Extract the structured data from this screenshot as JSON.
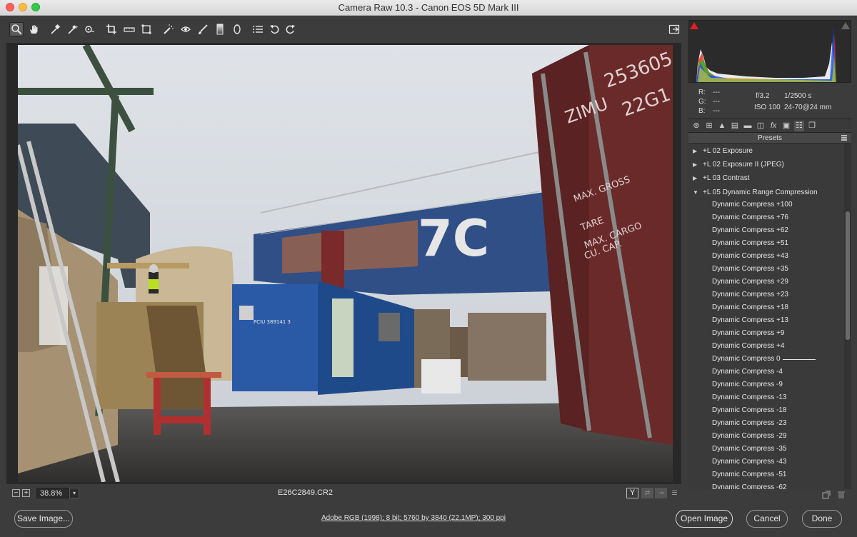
{
  "window": {
    "title": "Camera Raw 10.3  -  Canon EOS 5D Mark III"
  },
  "toolbar": {
    "tools": [
      {
        "icon": "zoom-icon",
        "active": true
      },
      {
        "icon": "hand-icon"
      },
      {
        "icon": "white-balance-icon"
      },
      {
        "icon": "color-sampler-icon"
      },
      {
        "icon": "targeted-adjustment-icon"
      },
      {
        "icon": "crop-icon"
      },
      {
        "icon": "straighten-icon"
      },
      {
        "icon": "transform-icon"
      },
      {
        "icon": "spot-removal-icon"
      },
      {
        "icon": "red-eye-icon"
      },
      {
        "icon": "adjustment-brush-icon"
      },
      {
        "icon": "graduated-filter-icon"
      },
      {
        "icon": "radial-filter-icon"
      },
      {
        "icon": "preferences-icon"
      },
      {
        "icon": "rotate-left-icon"
      },
      {
        "icon": "rotate-right-icon"
      }
    ],
    "fullscreen_icon": "fullscreen-toggle-icon"
  },
  "preview": {
    "zoom_minus": "−",
    "zoom_plus": "+",
    "zoom_value": "38.8%",
    "filename": "E26C2849.CR2",
    "view_mode": "Y"
  },
  "histogram": {
    "colors": {
      "red": "#e03020",
      "green": "#20c020",
      "blue": "#2050ff",
      "yellow": "#e0e000",
      "white": "#ffffff"
    }
  },
  "info": {
    "r_label": "R:",
    "r_val": "---",
    "g_label": "G:",
    "g_val": "---",
    "b_label": "B:",
    "b_val": "---",
    "aperture": "f/3.2",
    "shutter": "1/2500 s",
    "iso": "ISO 100",
    "lens": "24-70@24 mm"
  },
  "panel_tabs": [
    "basic-icon",
    "tone-curve-icon",
    "detail-icon",
    "hsl-icon",
    "split-toning-icon",
    "lens-corrections-icon",
    "effects-icon",
    "camera-calibration-icon",
    "presets-icon",
    "snapshots-icon"
  ],
  "presets": {
    "header": "Presets",
    "groups": [
      {
        "label": "+L 02 Exposure",
        "expanded": false
      },
      {
        "label": "+L 02 Exposure II (JPEG)",
        "expanded": false
      },
      {
        "label": "+L 03 Contrast",
        "expanded": false
      },
      {
        "label": "+L 05 Dynamic Range Compression",
        "expanded": true
      }
    ],
    "items": [
      "Dynamic Compress +100",
      "Dynamic Compress +76",
      "Dynamic Compress +62",
      "Dynamic Compress +51",
      "Dynamic Compress +43",
      "Dynamic Compress +35",
      "Dynamic Compress +29",
      "Dynamic Compress +23",
      "Dynamic Compress +18",
      "Dynamic Compress +13",
      "Dynamic Compress +9",
      "Dynamic Compress +4",
      "Dynamic Compress 0",
      "Dynamic Compress -4",
      "Dynamic Compress -9",
      "Dynamic Compress -13",
      "Dynamic Compress -18",
      "Dynamic Compress -23",
      "Dynamic Compress -29",
      "Dynamic Compress -35",
      "Dynamic Compress -43",
      "Dynamic Compress -51",
      "Dynamic Compress -62"
    ]
  },
  "bottom": {
    "save_label": "Save Image...",
    "workflow": "Adobe RGB (1998); 8 bit; 5760 by 3840 (22.1MP); 300 ppi",
    "open_label": "Open Image",
    "cancel_label": "Cancel",
    "done_label": "Done"
  }
}
